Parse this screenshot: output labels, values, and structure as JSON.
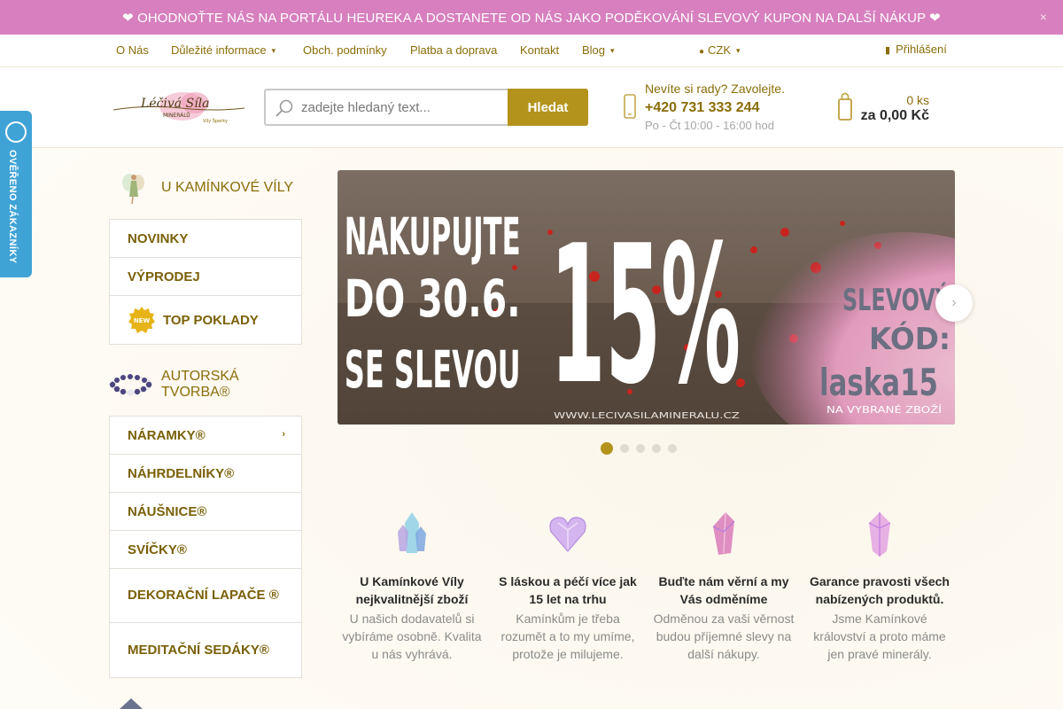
{
  "topbar": {
    "text": "❤ OHODNOŤTE NÁS NA PORTÁLU HEUREKA A DOSTANETE OD NÁS JAKO PODĚKOVÁNÍ SLEVOVÝ KUPON NA DALŠÍ NÁKUP ❤",
    "close": "×"
  },
  "nav": {
    "items": [
      "O Nás",
      "Důležité informace",
      "Obch. podmínky",
      "Platba a doprava",
      "Kontakt",
      "Blog"
    ],
    "currency": "CZK",
    "login": "Přihlášení"
  },
  "header": {
    "search_placeholder": "zadejte hledaný text...",
    "search_button": "Hledat",
    "help_title": "Nevíte si rady? Zavolejte.",
    "phone": "+420 731 333 244",
    "hours": "Po - Čt 10:00 - 16:00 hod",
    "cart_count": "0 ks",
    "cart_total": "za 0,00 Kč"
  },
  "badge": {
    "text": "OVĚŘENO ZÁKAZNÍKY"
  },
  "sidebar": {
    "section1_title": "U KAMÍNKOVÉ VÍLY",
    "section1_items": [
      "NOVINKY",
      "VÝPRODEJ",
      "TOP POKLADY"
    ],
    "new_label": "NEW",
    "section2_title_line1": "AUTORSKÁ",
    "section2_title_line2": "TVORBA®",
    "section2_items": [
      "NÁRAMKY®",
      "NÁHRDELNÍKY®",
      "NÁUŠNICE®",
      "SVÍČKY®",
      "DEKORAČNÍ LAPAČE ®",
      "MEDITAČNÍ SEDÁKY®"
    ]
  },
  "banner": {
    "line1": "NAKUPUJTE",
    "line2": "DO 30.6.",
    "line3": "SE SLEVOU",
    "percent": "15%",
    "code_label1": "SLEVOVÝ",
    "code_label2": "KÓD:",
    "code": "laska15",
    "note": "NA VYBRANÉ ZBOŽÍ",
    "url": "WWW.LECIVASILAMINERALU.CZ",
    "slide_count": 5,
    "active_slide": 1
  },
  "features": [
    {
      "title": "U Kamínkové Víly nejkvalitnější zboží",
      "desc": "U našich dodavatelů si vybíráme osobně. Kvalita u nás vyhrává."
    },
    {
      "title": "S láskou a péčí více jak 15 let na trhu",
      "desc": "Kamínkům je třeba rozumět a to my umíme, protože je milujeme."
    },
    {
      "title": "Buďte nám věrní a my Vás odměníme",
      "desc": "Odměnou za vaši věrnost budou příjemné slevy na další nákupy."
    },
    {
      "title": "Garance pravosti všech nabízených produktů.",
      "desc": "Jsme Kamínkové království a proto máme jen pravé minerály."
    }
  ],
  "colors": {
    "accent": "#b4931d",
    "topbar": "#d77fbf",
    "badge": "#3fa3d6",
    "link": "#8a6d08"
  }
}
